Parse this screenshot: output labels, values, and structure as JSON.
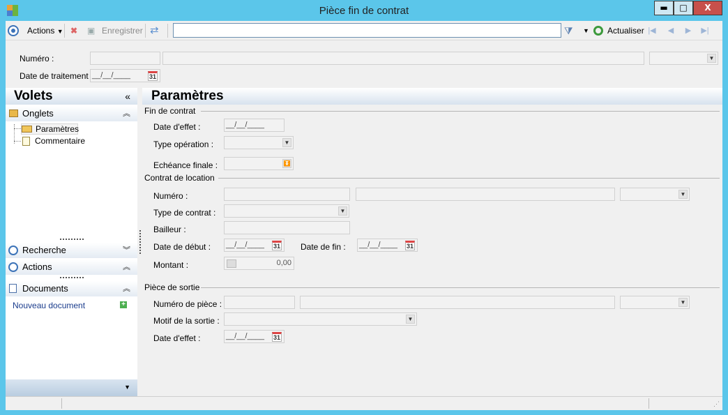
{
  "window": {
    "title": "Pièce fin de contrat",
    "minimize": "▬",
    "maximize": "□",
    "close": "X"
  },
  "toolbar": {
    "actions": "Actions",
    "save": "Enregistrer",
    "refresh": "Actualiser",
    "search_value": ""
  },
  "header": {
    "numero_label": "Numéro :",
    "date_traitement_label": "Date de traitement :",
    "date_placeholder": "__/__/____"
  },
  "sidebar": {
    "title": "Volets",
    "onglets": "Onglets",
    "tree": [
      "Paramètres",
      "Commentaire"
    ],
    "recherche": "Recherche",
    "actions": "Actions",
    "documents": "Documents",
    "new_document": "Nouveau document"
  },
  "main": {
    "title": "Paramètres",
    "fin_contrat": {
      "group": "Fin de contrat",
      "date_effet": "Date d'effet :",
      "type_operation": "Type opération :",
      "echeance_finale": "Echéance finale :"
    },
    "contrat_location": {
      "group": "Contrat de location",
      "numero": "Numéro :",
      "type_contrat": "Type de contrat :",
      "bailleur": "Bailleur :",
      "date_debut": "Date de début :",
      "date_fin": "Date de fin :",
      "montant": "Montant :",
      "montant_value": "0,00"
    },
    "piece_sortie": {
      "group": "Pièce de sortie",
      "numero_piece": "Numéro de pièce :",
      "motif_sortie": "Motif de la sortie :",
      "date_effet": "Date d'effet :"
    }
  },
  "date_placeholder": "__/__/____",
  "cal_label": "31",
  "colors": {
    "titlebar": "#5bc6ea",
    "pane_header": "#d7e2ee",
    "link": "#1a3c8c"
  }
}
